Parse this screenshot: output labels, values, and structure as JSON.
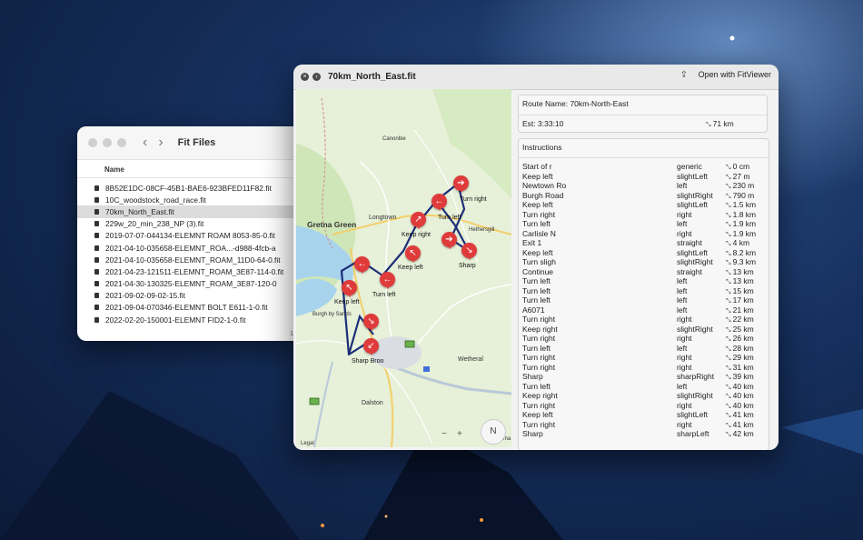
{
  "finder": {
    "title": "Fit Files",
    "column_header": "Name",
    "files": [
      "8B52E1DC-08CF-45B1-BAE6-923BFED11F82.fit",
      "10C_woodstock_road_race.fit",
      "70km_North_East.fit",
      "229w_20_min_238_NP (3).fit",
      "2019-07-07-044134-ELEMNT ROAM 8053-85-0.fit",
      "2021-04-10-035658-ELEMNT_ROA...-d988-4fcb-a",
      "2021-04-10-035658-ELEMNT_ROAM_11D0-64-0.fit",
      "2021-04-23-121511-ELEMNT_ROAM_3E87-114-0.fit",
      "2021-04-30-130325-ELEMNT_ROAM_3E87-120-0",
      "2021-09-02-09-02-15.fit",
      "2021-09-04-070346-ELEMNT BOLT E611-1-0.fit",
      "2022-02-20-150001-ELEMNT FID2-1-0.fit"
    ],
    "selected_index": 2,
    "footer": "1"
  },
  "viewer": {
    "title": "70km_North_East.fit",
    "open_button": "Open with FitViewer",
    "route_name": "Route Name: 70km-North-East",
    "est": "Est:   3:33:10",
    "total_distance": "71 km",
    "instructions_title": "Instructions",
    "instructions": [
      {
        "name": "Start of r",
        "type": "generic",
        "dist": "0 cm"
      },
      {
        "name": "Keep left",
        "type": "slightLeft",
        "dist": "27 m"
      },
      {
        "name": "Newtown Ro",
        "type": "left",
        "dist": "230 m"
      },
      {
        "name": "Burgh Road",
        "type": "slightRight",
        "dist": "790 m"
      },
      {
        "name": "Keep left",
        "type": "slightLeft",
        "dist": "1.5 km"
      },
      {
        "name": "Turn right",
        "type": "right",
        "dist": "1.8 km"
      },
      {
        "name": "Turn left",
        "type": "left",
        "dist": "1.9 km"
      },
      {
        "name": "Carlisle N",
        "type": "right",
        "dist": "1.9 km"
      },
      {
        "name": "Exit 1",
        "type": "straight",
        "dist": "4 km"
      },
      {
        "name": "Keep left",
        "type": "slightLeft",
        "dist": "8.2 km"
      },
      {
        "name": "Turn sligh",
        "type": "slightRight",
        "dist": "9.3 km"
      },
      {
        "name": "Continue",
        "type": "straight",
        "dist": "13 km"
      },
      {
        "name": "Turn left",
        "type": "left",
        "dist": "13 km"
      },
      {
        "name": "Turn left",
        "type": "left",
        "dist": "15 km"
      },
      {
        "name": "Turn left",
        "type": "left",
        "dist": "17 km"
      },
      {
        "name": "A6071",
        "type": "left",
        "dist": "21 km"
      },
      {
        "name": "Turn right",
        "type": "right",
        "dist": "22 km"
      },
      {
        "name": "Keep right",
        "type": "slightRight",
        "dist": "25 km"
      },
      {
        "name": "Turn right",
        "type": "right",
        "dist": "26 km"
      },
      {
        "name": "Turn left",
        "type": "left",
        "dist": "28 km"
      },
      {
        "name": "Turn right",
        "type": "right",
        "dist": "29 km"
      },
      {
        "name": "Turn right",
        "type": "right",
        "dist": "31 km"
      },
      {
        "name": "Sharp",
        "type": "sharpRight",
        "dist": "39 km"
      },
      {
        "name": "Turn left",
        "type": "left",
        "dist": "40 km"
      },
      {
        "name": "Keep right",
        "type": "slightRight",
        "dist": "40 km"
      },
      {
        "name": "Turn right",
        "type": "right",
        "dist": "40 km"
      },
      {
        "name": "Keep left",
        "type": "slightLeft",
        "dist": "41 km"
      },
      {
        "name": "Turn right",
        "type": "right",
        "dist": "41 km"
      },
      {
        "name": "Sharp",
        "type": "sharpLeft",
        "dist": "42 km"
      }
    ]
  },
  "map": {
    "places": {
      "canonbie": "Canonbie",
      "gretna": "Gretna Green",
      "longtown": "Longtown",
      "hethersgill": "Hethersgill",
      "burgh": "Burgh by Sands",
      "wetheral": "Wetheral",
      "dalston": "Dalston",
      "arma": "Arma"
    },
    "markers": {
      "turn_right_1": "Turn right",
      "turn_left_1": "Turn left",
      "keep_right": "Keep right",
      "keep_left_1": "Keep left",
      "turn_left_2": "Turn left",
      "keep_left_2": "Keep left",
      "sharp": "Sharp",
      "sharp_broo": "Sharp Broo"
    },
    "compass": "N",
    "zoom_minus": "−",
    "zoom_plus": "+",
    "legal": "Legal"
  }
}
